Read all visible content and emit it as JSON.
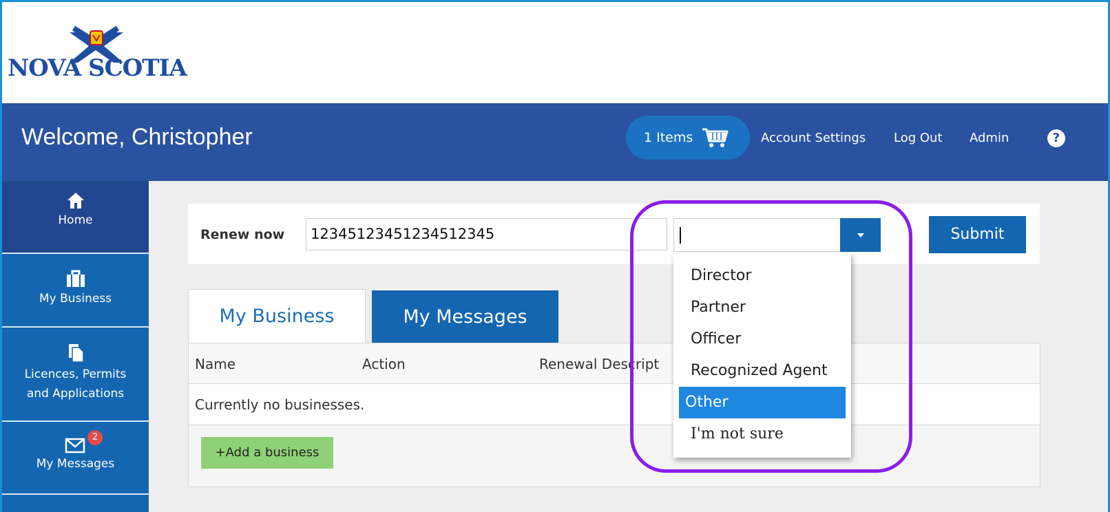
{
  "logo": {
    "text": "NOVA SCOTIA"
  },
  "header": {
    "welcome": "Welcome, Christopher",
    "cart_label": "1 Items",
    "links": [
      "Account Settings",
      "Log Out",
      "Admin"
    ],
    "help_icon": "?"
  },
  "sidebar": {
    "items": [
      {
        "label": "Home",
        "icon": "home-icon",
        "active": true
      },
      {
        "label": "My Business",
        "icon": "briefcase-icon"
      },
      {
        "label": "Licences, Permits",
        "label2": "and Applications",
        "icon": "document-icon"
      },
      {
        "label": "My Messages",
        "icon": "envelope-icon",
        "badge": "2"
      }
    ]
  },
  "renew": {
    "label": "Renew now",
    "value": "12345123451234512345",
    "submit": "Submit"
  },
  "dropdown": {
    "options": [
      "Director",
      "Partner",
      "Officer",
      "Recognized Agent",
      "Other",
      "I'm not sure"
    ],
    "selected": "Other"
  },
  "tabs": [
    "My Business",
    "My Messages"
  ],
  "table": {
    "columns": [
      "Name",
      "Action",
      "Renewal Descript"
    ],
    "empty_text": "Currently no businesses.",
    "add_button": "+Add a business"
  },
  "colors": {
    "header": "#2a52a0",
    "sidebar": "#1466b0",
    "highlight": "#8a1ee8",
    "selected_option": "#1e87e0",
    "add_button": "#8fd176"
  }
}
